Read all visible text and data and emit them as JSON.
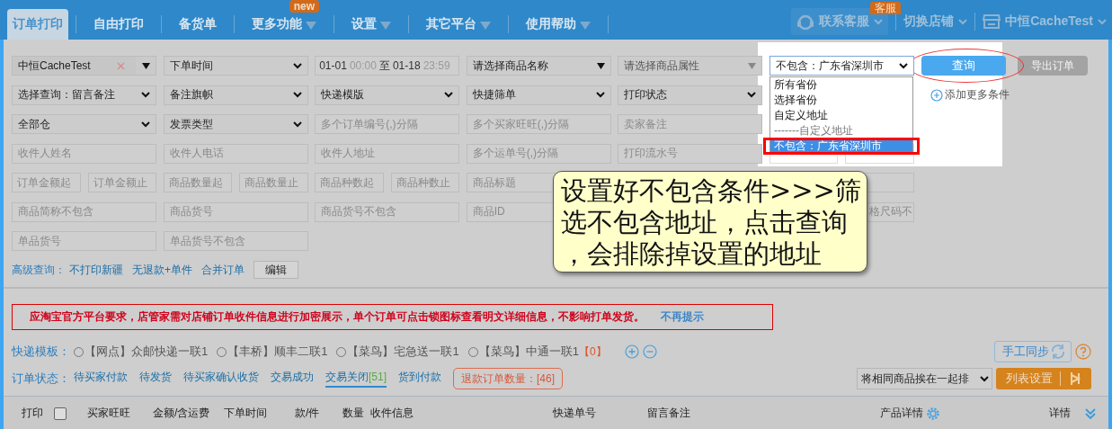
{
  "nav": {
    "tabs": [
      {
        "label": "订单打印",
        "selected": true,
        "dropdown": false
      },
      {
        "label": "自由打印",
        "selected": false,
        "dropdown": false
      },
      {
        "label": "备货单",
        "selected": false,
        "dropdown": false
      },
      {
        "label": "更多功能",
        "selected": false,
        "dropdown": true,
        "badge": "new"
      },
      {
        "label": "设置",
        "selected": false,
        "dropdown": true
      },
      {
        "label": "其它平台",
        "selected": false,
        "dropdown": true
      },
      {
        "label": "使用帮助",
        "selected": false,
        "dropdown": true
      }
    ],
    "contact": {
      "label": "联系客服",
      "badge": "客服"
    },
    "switch_store": "切换店铺",
    "account": "中恒CacheTest"
  },
  "filters": {
    "rows": [
      [
        {
          "kind": "shop",
          "value": "中恒CacheTest"
        },
        {
          "kind": "select",
          "value": "下单时间"
        },
        {
          "kind": "daterange",
          "start_date": "01-01",
          "start_time": "00:00",
          "separator": "至",
          "end_date": "01-18",
          "end_time": "23:59"
        },
        {
          "kind": "combo",
          "value": "请选择商品名称",
          "disabled": false
        },
        {
          "kind": "combo",
          "value": "请选择商品属性",
          "disabled": true
        },
        {
          "kind": "province",
          "value": "不包含：广东省深圳市",
          "open": true,
          "options": [
            {
              "label": "所有省份",
              "selected": false,
              "disabled": false
            },
            {
              "label": "选择省份",
              "selected": false,
              "disabled": false
            },
            {
              "label": "自定义地址",
              "selected": false,
              "disabled": false
            },
            {
              "label": "-------自定义地址",
              "selected": false,
              "disabled": true
            },
            {
              "label": "不包含：广东省深圳市",
              "selected": true,
              "disabled": false
            }
          ]
        }
      ],
      [
        {
          "kind": "select",
          "value": "选择查询：留言备注"
        },
        {
          "kind": "select",
          "value": "备注旗帜"
        },
        {
          "kind": "select",
          "value": "快递模版"
        },
        {
          "kind": "select",
          "value": "快捷筛单"
        },
        {
          "kind": "select",
          "value": "打印状态"
        }
      ],
      [
        {
          "kind": "select",
          "value": "全部仓"
        },
        {
          "kind": "select",
          "value": "发票类型"
        },
        {
          "kind": "field",
          "placeholder": "多个订单编号(,)分隔"
        },
        {
          "kind": "field",
          "placeholder": "多个买家旺旺(,)分隔"
        },
        {
          "kind": "field",
          "placeholder": "卖家备注"
        }
      ],
      [
        {
          "kind": "field",
          "placeholder": "收件人姓名"
        },
        {
          "kind": "field",
          "placeholder": "收件人电话"
        },
        {
          "kind": "field",
          "placeholder": "收件人地址"
        },
        {
          "kind": "field",
          "placeholder": "多个运单号(,)分隔"
        },
        {
          "kind": "field",
          "placeholder": "打印流水号"
        },
        {
          "kind": "pair",
          "fields": [
            {
              "kind": "half"
            },
            {
              "kind": "half"
            }
          ]
        }
      ],
      [
        {
          "kind": "pair",
          "fields": [
            {
              "kind": "half",
              "placeholder": "订单金额起"
            },
            {
              "kind": "half",
              "placeholder": "订单金额止"
            }
          ]
        },
        {
          "kind": "pair",
          "fields": [
            {
              "kind": "half",
              "placeholder": "商品数量起"
            },
            {
              "kind": "half",
              "placeholder": "商品数量止"
            }
          ]
        },
        {
          "kind": "pair",
          "fields": [
            {
              "kind": "half",
              "placeholder": "商品种数起"
            },
            {
              "kind": "half",
              "placeholder": "商品种数止"
            }
          ]
        },
        {
          "kind": "field",
          "placeholder": "商品标题"
        },
        "",
        {
          "kind": "end_field"
        }
      ],
      [
        {
          "kind": "field",
          "placeholder": "商品简称不包含"
        },
        {
          "kind": "field",
          "placeholder": "商品货号"
        },
        {
          "kind": "field",
          "placeholder": "商品货号不包含"
        },
        {
          "kind": "field",
          "placeholder": "商品ID"
        },
        "",
        {
          "kind": "end_field",
          "placeholder": "格尺码不"
        }
      ],
      [
        {
          "kind": "field",
          "placeholder": "单品货号"
        },
        {
          "kind": "field",
          "placeholder": "单品货号不包含"
        }
      ]
    ],
    "query_button": "查询",
    "export_button": {
      "label": "导出订单",
      "disabled": true
    },
    "add_link": "添加更多条件"
  },
  "advanced": {
    "label": "高级查询：",
    "links": [
      "不打印新疆",
      "无退款+单件",
      "合并订单"
    ],
    "edit_button": "编辑"
  },
  "tooltip": "设置好不包含条件>>>筛选不包含地址，点击查询，会排除掉设置的地址",
  "notice": {
    "text": "应淘宝官方平台要求，店管家需对店铺订单收件信息进行加密展示，单个订单可点击锁图标查看明文详细信息，不影响打单发货。",
    "link": "不再提示"
  },
  "templates": {
    "label": "快递模板：",
    "options": [
      {
        "label": "【网点】众邮快递一联1",
        "selected": false
      },
      {
        "label": "【丰桥】顺丰二联1",
        "selected": false
      },
      {
        "label": "【菜鸟】宅急送一联1",
        "selected": false
      },
      {
        "label": "【菜鸟】中通一联1",
        "selected": false,
        "count": "【0】"
      }
    ],
    "sync_button": "手工同步"
  },
  "status": {
    "label": "订单状态：",
    "tabs": [
      {
        "label": "待买家付款",
        "selected": false
      },
      {
        "label": "待发货",
        "selected": false
      },
      {
        "label": "待买家确认收货",
        "selected": false
      },
      {
        "label": "交易成功",
        "selected": false
      },
      {
        "label": "交易关闭",
        "count": "[51]",
        "selected": true
      },
      {
        "label": "货到付款",
        "selected": false
      }
    ],
    "refund": {
      "label": "退款订单数量：",
      "count": "[46]"
    },
    "sort_select": "将相同商品挨在一起排",
    "list_settings": "列表设置"
  },
  "table": {
    "columns": [
      {
        "kind": "text",
        "label": "打印"
      },
      {
        "kind": "checkbox",
        "checked": false
      },
      {
        "kind": "text",
        "label": "买家旺旺"
      },
      {
        "kind": "text",
        "label": "金额/含运费"
      },
      {
        "kind": "text",
        "label": "下单时间"
      },
      {
        "kind": "text",
        "label": "款/件"
      },
      {
        "kind": "text",
        "label": "数量"
      },
      {
        "kind": "text",
        "label": "收件信息"
      },
      {
        "kind": "text",
        "label": "快递单号"
      },
      {
        "kind": "text",
        "label": "留言备注"
      },
      {
        "kind": "settings",
        "label": "产品详情"
      },
      {
        "kind": "expand",
        "label": "详情"
      }
    ]
  }
}
